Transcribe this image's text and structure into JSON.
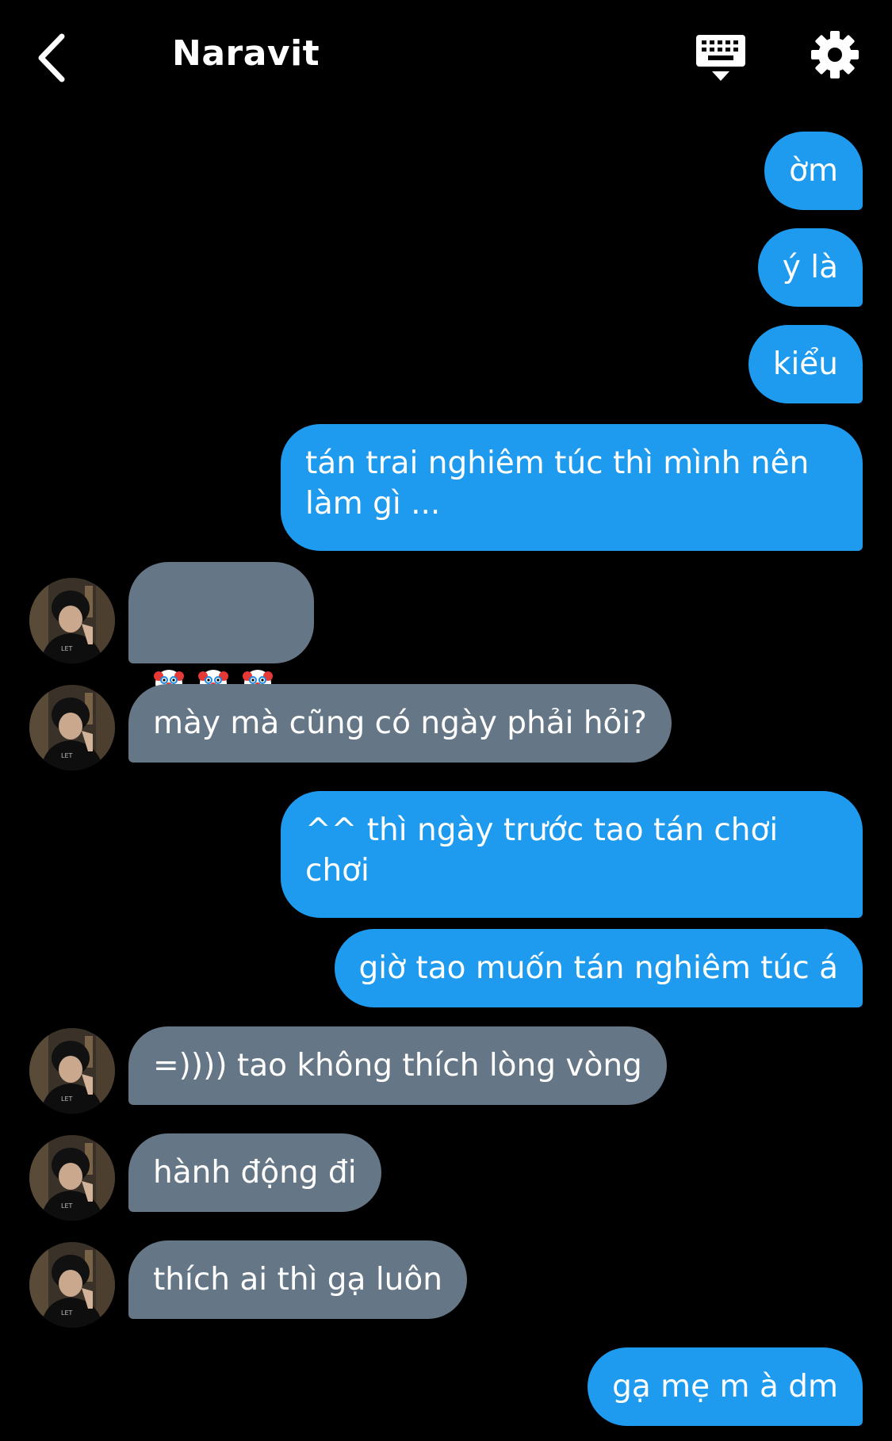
{
  "header": {
    "contact_name": "Naravit",
    "icons": {
      "back": "chevron-left-icon",
      "keyboard": "keyboard-hide-icon",
      "settings": "gear-icon"
    }
  },
  "colors": {
    "background": "#000000",
    "outgoing_bubble": "#1e9bef",
    "incoming_bubble": "#657686",
    "text": "#ffffff"
  },
  "messages": [
    {
      "direction": "outgoing",
      "text": "ờm"
    },
    {
      "direction": "outgoing",
      "text": "ý là"
    },
    {
      "direction": "outgoing",
      "text": "kiểu"
    },
    {
      "direction": "outgoing",
      "text": "tán trai nghiêm túc thì mình nên làm gì ..."
    },
    {
      "direction": "incoming",
      "emoji": [
        "clown-face",
        "clown-face",
        "clown-face"
      ]
    },
    {
      "direction": "incoming",
      "text": "mày mà cũng có ngày phải hỏi?"
    },
    {
      "direction": "outgoing",
      "text": "^^ thì ngày trước tao tán chơi chơi"
    },
    {
      "direction": "outgoing",
      "text": "giờ tao muốn tán nghiêm túc á"
    },
    {
      "direction": "incoming",
      "text": "=)))) tao không thích lòng vòng"
    },
    {
      "direction": "incoming",
      "text": "hành động đi"
    },
    {
      "direction": "incoming",
      "text": "thích ai thì gạ luôn"
    },
    {
      "direction": "outgoing",
      "text": "gạ mẹ m à dm"
    }
  ]
}
